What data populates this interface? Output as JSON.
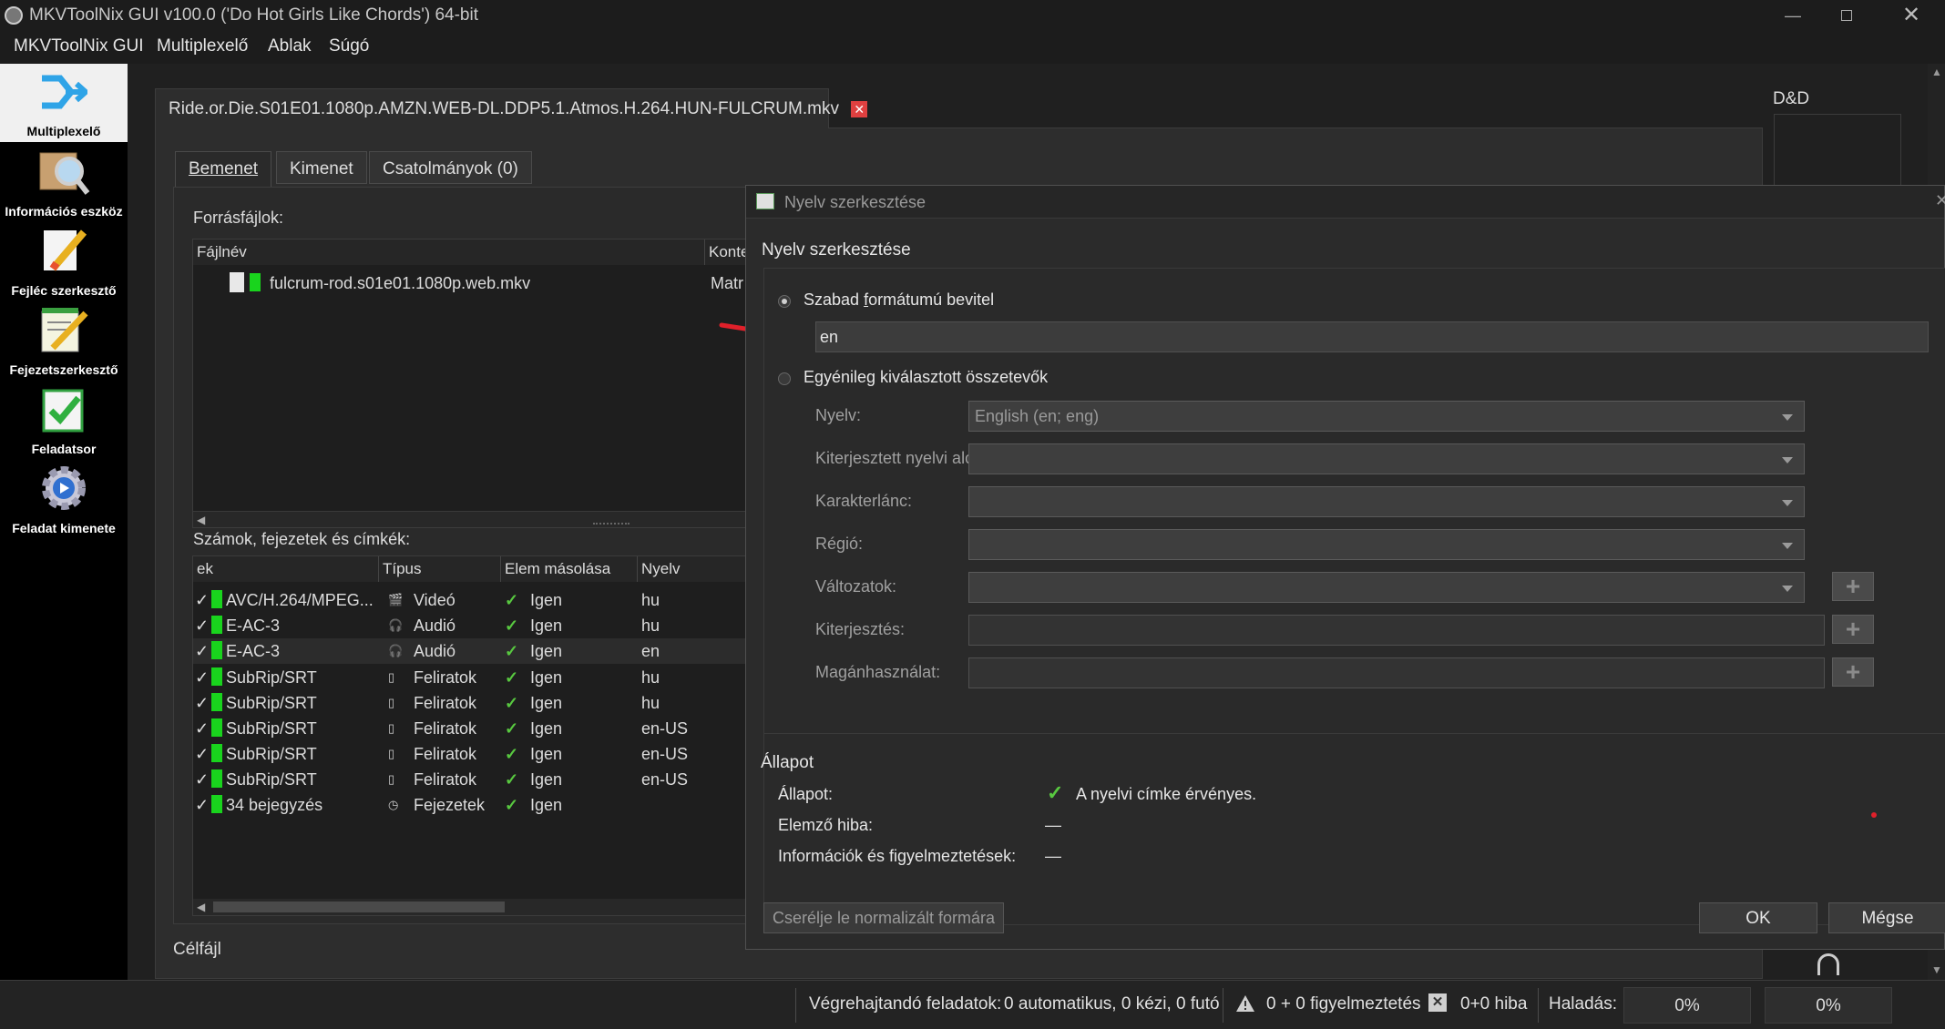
{
  "window": {
    "title": "MKVToolNix GUI v100.0 ('Do Hot Girls Like Chords') 64-bit"
  },
  "menu": [
    "MKVToolNix GUI",
    "Multiplexelő",
    "Ablak",
    "Súgó"
  ],
  "sidebar": [
    {
      "label": "Multiplexelő",
      "icon": "multiplexer-icon"
    },
    {
      "label": "Információs eszköz",
      "icon": "info-tool-icon"
    },
    {
      "label": "Fejléc szerkesztő",
      "icon": "header-editor-icon"
    },
    {
      "label": "Fejezetszerkesztő",
      "icon": "chapter-editor-icon"
    },
    {
      "label": "Feladatsor",
      "icon": "job-queue-icon"
    },
    {
      "label": "Feladat kimenete",
      "icon": "job-output-icon"
    }
  ],
  "file_tab": "Ride.or.Die.S01E01.1080p.AMZN.WEB-DL.DDP5.1.Atmos.H.264.HUN-FULCRUM.mkv",
  "tabs": [
    "Bemenet",
    "Kimenet",
    "Csatolmányok (0)"
  ],
  "source": {
    "label": "Forrásfájlok:",
    "columns": [
      "Fájlnév",
      "Konte"
    ],
    "file": {
      "name": "fulcrum-rod.s01e01.1080p.web.mkv",
      "container": "Matr"
    }
  },
  "tracks": {
    "label": "Számok, fejezetek és címkék:",
    "columns": [
      "ek",
      "Típus",
      "Elem másolása",
      "Nyelv"
    ],
    "rows": [
      {
        "codec": "AVC/H.264/MPEG...",
        "type": "Videó",
        "copy": "Igen",
        "lang": "hu"
      },
      {
        "codec": "E-AC-3",
        "type": "Audió",
        "copy": "Igen",
        "lang": "hu"
      },
      {
        "codec": "E-AC-3",
        "type": "Audió",
        "copy": "Igen",
        "lang": "en"
      },
      {
        "codec": "SubRip/SRT",
        "type": "Feliratok",
        "copy": "Igen",
        "lang": "hu"
      },
      {
        "codec": "SubRip/SRT",
        "type": "Feliratok",
        "copy": "Igen",
        "lang": "hu"
      },
      {
        "codec": "SubRip/SRT",
        "type": "Feliratok",
        "copy": "Igen",
        "lang": "en-US"
      },
      {
        "codec": "SubRip/SRT",
        "type": "Feliratok",
        "copy": "Igen",
        "lang": "en-US"
      },
      {
        "codec": "SubRip/SRT",
        "type": "Feliratok",
        "copy": "Igen",
        "lang": "en-US"
      },
      {
        "codec": "34 bejegyzés",
        "type": "Fejezetek",
        "copy": "Igen",
        "lang": ""
      }
    ]
  },
  "target_label": "Célfájl",
  "dnd_label": "D&D",
  "dialog": {
    "title": "Nyelv szerkesztése",
    "heading": "Nyelv szerkesztése",
    "free_form": {
      "label": "Szabad formátumú bevitel",
      "value": "en"
    },
    "components": {
      "label": "Egyénileg kiválasztott összetevők",
      "fields": [
        {
          "label": "Nyelv:",
          "value": "English (en; eng)",
          "kind": "combo"
        },
        {
          "label": "Kiterjesztett nyelvi alcímke:",
          "value": "",
          "kind": "combo"
        },
        {
          "label": "Karakterlánc:",
          "value": "",
          "kind": "combo"
        },
        {
          "label": "Régió:",
          "value": "",
          "kind": "combo"
        },
        {
          "label": "Változatok:",
          "value": "",
          "kind": "combo-plus"
        },
        {
          "label": "Kiterjesztés:",
          "value": "",
          "kind": "text-plus"
        },
        {
          "label": "Magánhasználat:",
          "value": "",
          "kind": "text-plus"
        }
      ]
    },
    "status": {
      "heading": "Állapot",
      "rows": [
        {
          "label": "Állapot:",
          "value": "A nyelvi címke érvényes."
        },
        {
          "label": "Elemző hiba:",
          "value": "—"
        },
        {
          "label": "Információk és figyelmeztetések:",
          "value": "—"
        }
      ]
    },
    "buttons": {
      "normalize": "Cserélje le normalizált formára",
      "ok": "OK",
      "cancel": "Mégse"
    }
  },
  "statusbar": {
    "jobs_label": "Végrehajtandó feladatok:",
    "jobs_value": "0 automatikus, 0 kézi, 0 futó",
    "warnings": "0 + 0 figyelmeztetés",
    "errors": "0+0 hiba",
    "progress_label": "Haladás:",
    "progress1": "0%",
    "progress2": "0%"
  },
  "colors": {
    "accent_green": "#19d41d",
    "annotation_red": "#e0202a",
    "check": "#58c840"
  }
}
